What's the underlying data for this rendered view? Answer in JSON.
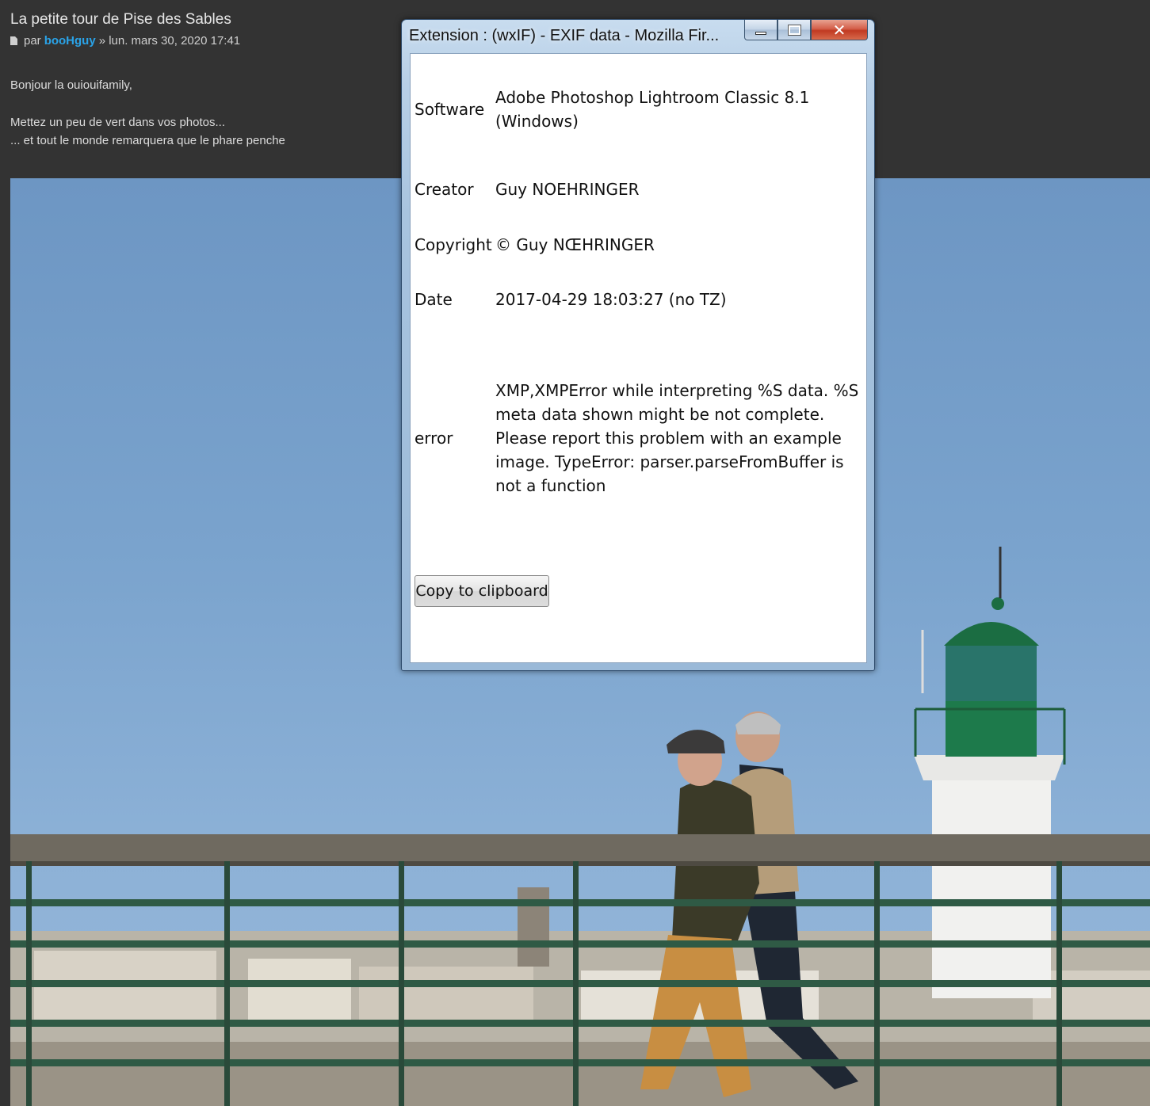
{
  "post": {
    "title": "La petite tour de Pise des Sables",
    "meta_prefix": "par",
    "author": "booHguy",
    "meta_suffix": "» lun. mars 30, 2020 17:41",
    "body": {
      "line1": "Bonjour la ouiouifamily,",
      "line2": "Mettez un peu de vert dans vos photos...",
      "line3": "... et tout le monde remarquera que le phare penche"
    }
  },
  "popup": {
    "title": "Extension : (wxIF) - EXIF data - Mozilla Fir...",
    "rows": [
      {
        "key": "Software",
        "value": "Adobe Photoshop Lightroom Classic 8.1 (Windows)"
      },
      {
        "key": "Creator",
        "value": "Guy NOEHRINGER"
      },
      {
        "key": "Copyright",
        "value": "© Guy NŒHRINGER"
      },
      {
        "key": "Date",
        "value": "2017-04-29 18:03:27 (no TZ)"
      },
      {
        "key": "error",
        "value": "XMP,XMPError while interpreting %S data. %S meta data shown might be not complete. Please report this problem with an example image. TypeError: parser.parseFromBuffer is not a function"
      }
    ],
    "copy_button": "Copy to clipboard"
  },
  "colors": {
    "page_bg": "#333333",
    "author_link": "#2aa3e8",
    "sky": "#7aa3cd",
    "lighthouse_green": "#1e7a4a"
  }
}
